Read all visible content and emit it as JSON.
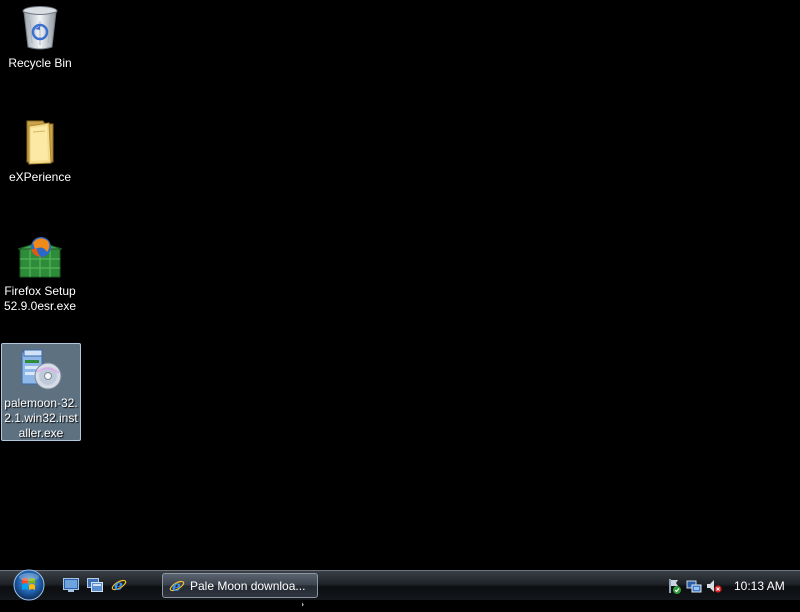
{
  "desktop": {
    "icons": [
      {
        "label": "Recycle Bin",
        "icon": "recycle-bin-icon"
      },
      {
        "label": "eXPerience",
        "icon": "folder-icon"
      },
      {
        "label": "Firefox Setup\n52.9.0esr.exe",
        "icon": "firefox-installer-icon"
      },
      {
        "label": "palemoon-32.\n2.1.win32.inst\naller.exe",
        "icon": "installer-disc-icon",
        "selected": true
      }
    ]
  },
  "taskbar": {
    "start_icon": "windows-orb-icon",
    "quick_launch": [
      {
        "icon": "show-desktop-icon"
      },
      {
        "icon": "switch-windows-icon"
      },
      {
        "icon": "internet-explorer-icon"
      }
    ],
    "task": {
      "label": "Pale Moon downloa...",
      "icon": "internet-explorer-icon"
    },
    "tray": {
      "icons": [
        "network-security-icon",
        "network-icon",
        "volume-muted-icon"
      ],
      "clock": "10:13 AM"
    }
  },
  "colors": {
    "desktop_background": "#000000",
    "selection": "#aacdeb",
    "taskbar": "#1f2328"
  }
}
